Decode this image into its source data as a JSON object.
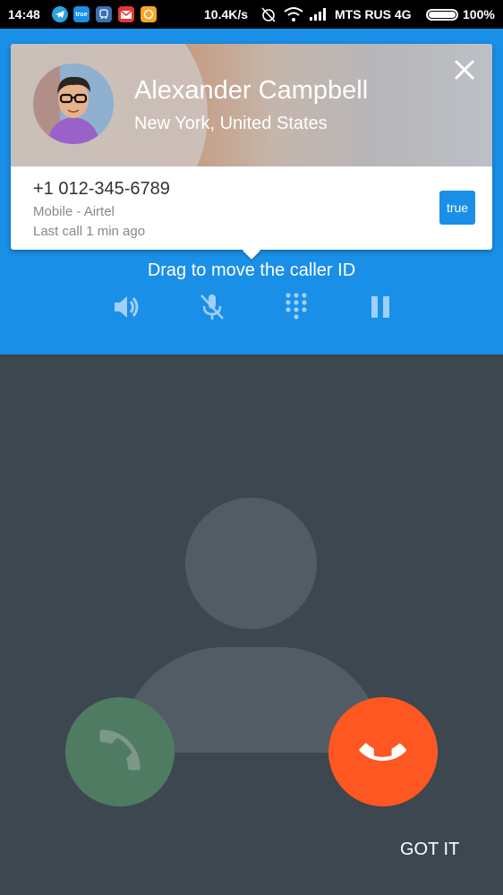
{
  "status_bar": {
    "time": "14:48",
    "speed": "10.4K/s",
    "carrier": "MTS RUS 4G",
    "battery": "100%",
    "app_icons": [
      "telegram-icon",
      "truecaller-icon",
      "train-icon",
      "gmail-icon",
      "chat-icon"
    ],
    "truecaller_label": "true"
  },
  "caller": {
    "name": "Alexander Campbell",
    "location": "New York, United States",
    "number": "+1 012-345-6789",
    "type": "Mobile - Airtel",
    "last_call": "Last call 1 min ago",
    "badge": "true"
  },
  "drag_hint": "Drag to move the caller ID",
  "controls": [
    "speaker-icon",
    "mute-mic-icon",
    "dialpad-icon",
    "pause-icon"
  ],
  "actions": {
    "accept": "accept-call",
    "decline": "decline-call",
    "got_it": "GOT IT"
  },
  "colors": {
    "accent_blue": "#1a8fe8",
    "decline_orange": "#ff5722",
    "accept_green": "#4f7b63",
    "background": "#3c4750"
  }
}
